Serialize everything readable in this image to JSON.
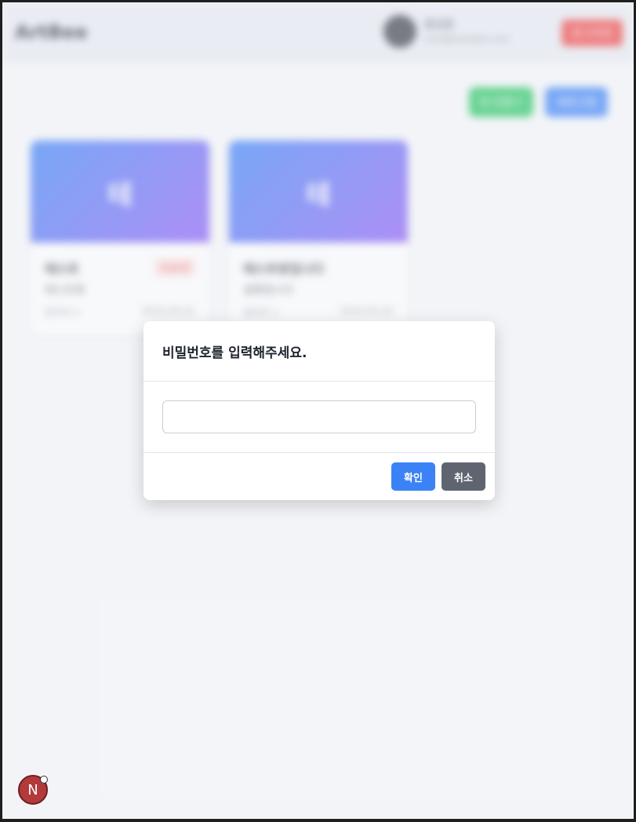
{
  "header": {
    "brand": "ArtBee",
    "user_name": "홍길동",
    "user_email": "user@example.com",
    "logout_label": "로그아웃"
  },
  "actions": {
    "green_label": "방 만들기",
    "blue_label": "새로고침"
  },
  "cards": [
    {
      "banner_letter": "테",
      "title": "테스트",
      "badge": "비공개",
      "subtitle": "테스트방",
      "meta_left": "참여자 2",
      "meta_right": "2024.05.01"
    },
    {
      "banner_letter": "테",
      "title": "테스트방입니다",
      "subtitle": "설명입니다",
      "meta_left": "참여자 1",
      "meta_right": "2024.05.02"
    }
  ],
  "modal": {
    "title": "비밀번호를 입력해주세요.",
    "input_value": "",
    "confirm_label": "확인",
    "cancel_label": "취소"
  },
  "dev_badge": {
    "letter": "N"
  },
  "colors": {
    "primary": "#3b82f6",
    "secondary": "#5f6570",
    "danger": "#ef4444",
    "success": "#22c55e"
  }
}
